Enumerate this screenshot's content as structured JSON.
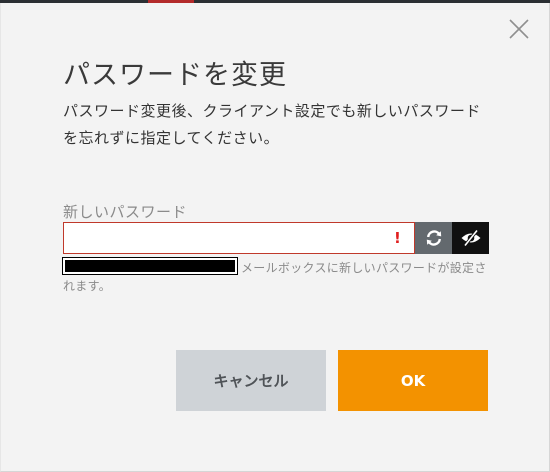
{
  "dialog": {
    "title": "パスワードを変更",
    "description": "パスワード変更後、クライアント設定でも新しいパスワードを忘れずに指定してください。",
    "close_icon": "close-icon"
  },
  "password_field": {
    "label": "新しいパスワード",
    "value": "",
    "error_mark": "!",
    "regenerate_icon": "refresh-icon",
    "reveal_icon": "eye-slash-icon"
  },
  "hint": {
    "text": "メールボックスに新しいパスワードが設定されます。"
  },
  "buttons": {
    "cancel_label": "キャンセル",
    "ok_label": "OK"
  },
  "colors": {
    "ok_background": "#f39200",
    "cancel_background": "#cfd3d7",
    "error_border": "#c0392b",
    "error_mark": "#e01e1e"
  }
}
